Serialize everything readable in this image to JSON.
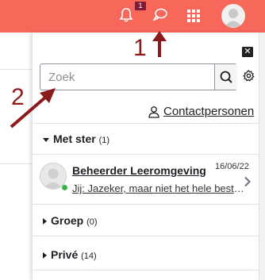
{
  "topbar": {
    "notification_count": "1",
    "colors": {
      "bar": "#f7685b",
      "badge": "#7b1d36"
    }
  },
  "drawer": {
    "search": {
      "placeholder": "Zoek",
      "value": ""
    },
    "contacts_link": "Contactpersonen",
    "sections": {
      "starred": {
        "title": "Met ster",
        "count": "(1)"
      },
      "group": {
        "title": "Groep",
        "count": "(0)"
      },
      "private": {
        "title": "Privé",
        "count": "(14)"
      }
    },
    "conversation": {
      "name": "Beheerder Leeromgeving",
      "date": "16/06/22",
      "preview": "Jij: Jazeker, maar niet het hele bestand"
    }
  },
  "annotations": {
    "one": "1",
    "two": "2"
  }
}
